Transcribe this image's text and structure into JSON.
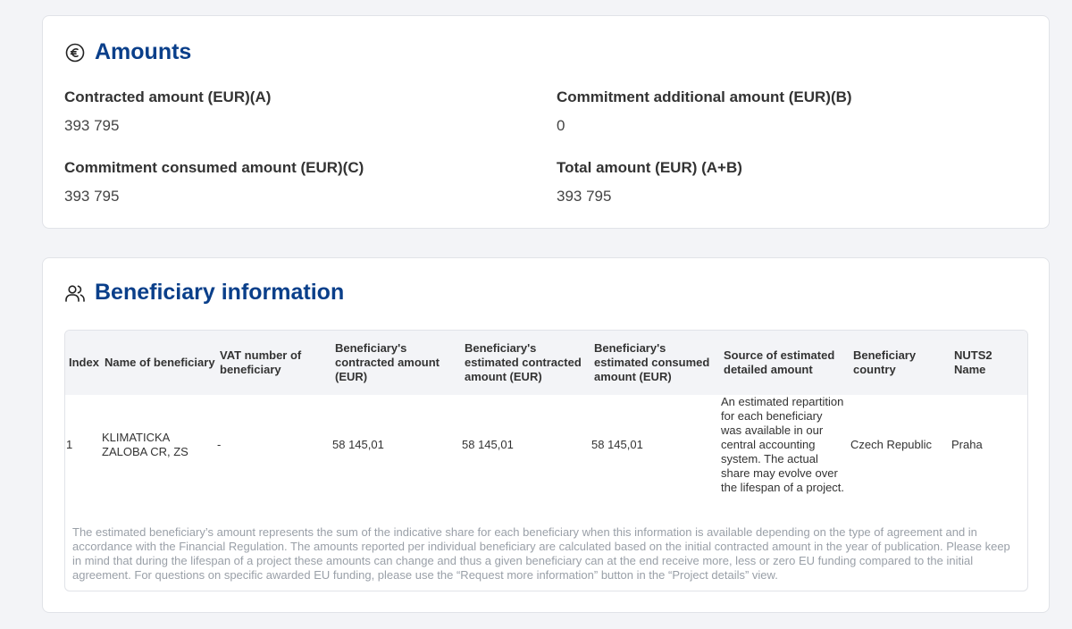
{
  "amounts": {
    "title": "Amounts",
    "icon": "euro-circle-icon",
    "contracted_label": "Contracted amount (EUR)(A)",
    "contracted_value": "393 795",
    "additional_label": "Commitment additional amount (EUR)(B)",
    "additional_value": "0",
    "consumed_label": "Commitment consumed amount (EUR)(C)",
    "consumed_value": "393 795",
    "total_label": "Total amount (EUR) (A+B)",
    "total_value": "393 795"
  },
  "beneficiary": {
    "title": "Beneficiary information",
    "icon": "users-icon",
    "columns": [
      "Index",
      "Name of beneficiary",
      "VAT number of beneficiary",
      "Beneficiary's contracted amount (EUR)",
      "Beneficiary's estimated contracted amount (EUR)",
      "Beneficiary's estimated consumed amount (EUR)",
      "Source of estimated detailed amount",
      "Beneficiary country",
      "NUTS2 Name"
    ],
    "rows": [
      [
        "1",
        "KLIMATICKA ZALOBA CR, ZS",
        "-",
        "58 145,01",
        "58 145,01",
        "58 145,01",
        "An estimated repartition for each beneficiary was available in our central accounting system. The actual share may evolve over the lifespan of a project.",
        "Czech Republic",
        "Praha"
      ]
    ],
    "note": "The estimated beneficiary’s amount represents the sum of the indicative share for each beneficiary when this information is available depending on the type of agreement and in accordance with the Financial Regulation. The amounts reported per individual beneficiary are calculated based on the initial contracted amount in the year of publication. Please keep in mind that during the lifespan of a project these amounts can change and thus a given beneficiary can at the end receive more, less or zero EU funding compared to the initial agreement. For questions on specific awarded EU funding, please use the “Request more information” button in the “Project details” view."
  },
  "colors": {
    "title": "#0a3f8a",
    "header_bg": "#f3f4f7",
    "note": "#9aa0a8"
  }
}
